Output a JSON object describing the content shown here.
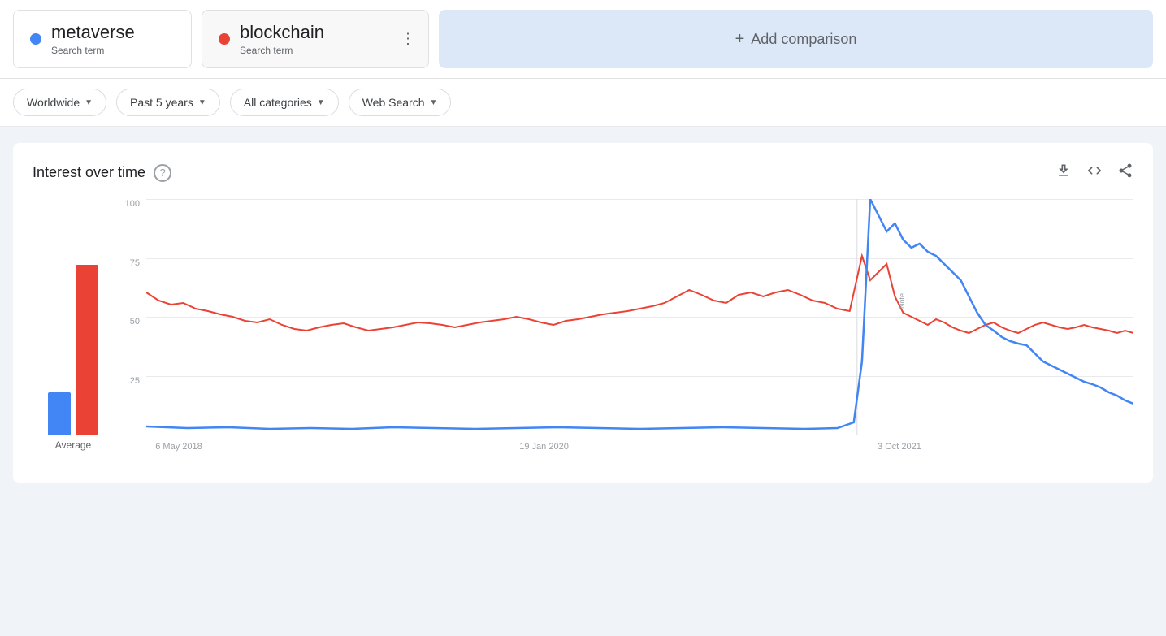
{
  "searchTerms": [
    {
      "id": "term1",
      "name": "metaverse",
      "type": "Search term",
      "dotColor": "blue"
    },
    {
      "id": "term2",
      "name": "blockchain",
      "type": "Search term",
      "dotColor": "red"
    }
  ],
  "addComparison": {
    "label": "Add comparison",
    "plus": "+"
  },
  "filters": {
    "location": {
      "label": "Worldwide"
    },
    "timeRange": {
      "label": "Past 5 years"
    },
    "category": {
      "label": "All categories"
    },
    "searchType": {
      "label": "Web Search"
    }
  },
  "chart": {
    "title": "Interest over time",
    "helpIcon": "?",
    "downloadLabel": "download",
    "embedLabel": "embed",
    "shareLabel": "share",
    "yAxisLabels": [
      "100",
      "75",
      "50",
      "25"
    ],
    "xAxisLabels": [
      {
        "label": "6 May 2018",
        "pct": 0
      },
      {
        "label": "19 Jan 2020",
        "pct": 37
      },
      {
        "label": "3 Oct 2021",
        "pct": 72
      }
    ],
    "avgLabel": "Average",
    "avgBlueHeight": 18,
    "avgRedHeight": 72,
    "noteLabel": "Note"
  }
}
